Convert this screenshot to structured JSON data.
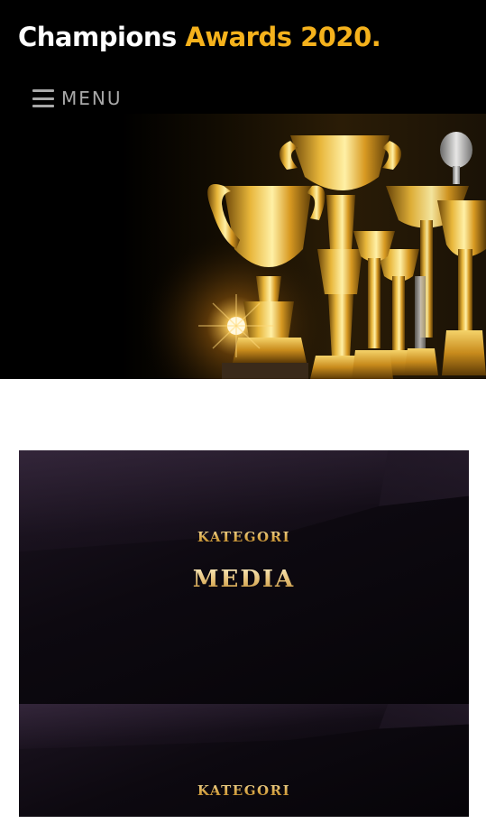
{
  "header": {
    "title_part1": "Champions ",
    "title_part2": "Awards 2020.",
    "menu_label": "MENU",
    "background": "#000000",
    "accent_color": "#f5b21c"
  },
  "hero": {
    "image_subject": "golden-trophies"
  },
  "cards": [
    {
      "label": "KATEGORI",
      "name": "MEDIA"
    },
    {
      "label": "KATEGORI"
    }
  ]
}
